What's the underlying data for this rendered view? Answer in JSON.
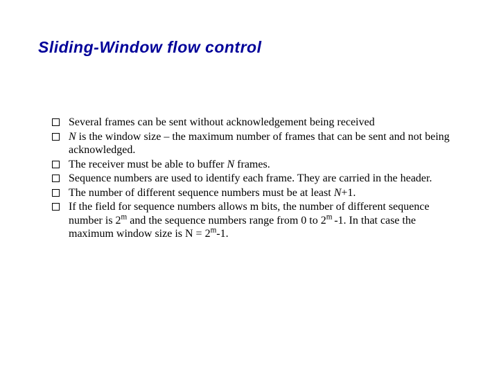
{
  "title": "Sliding-Window flow control",
  "bullets": {
    "b0": "Several frames can be sent without acknowledgement being received",
    "b1_pre": "",
    "b1_n": "N",
    "b1_post": " is the window size – the maximum number of frames that can be sent and not being acknowledged.",
    "b2_pre": "The receiver must be able to buffer ",
    "b2_n": "N",
    "b2_post": " frames.",
    "b3": "Sequence numbers are used to identify each frame. They are carried in the header.",
    "b4_pre": "The number of different sequence numbers must be at least ",
    "b4_n": "N",
    "b4_post": "+1.",
    "b5_a": "If the field for sequence numbers allows m bits, the number of different sequence number is 2",
    "b5_m1": "m",
    "b5_b": " and the sequence numbers range from 0 to 2",
    "b5_m2": "m ",
    "b5_c": "-1. In that case the maximum window size is N = 2",
    "b5_m3": "m",
    "b5_d": "-1."
  }
}
